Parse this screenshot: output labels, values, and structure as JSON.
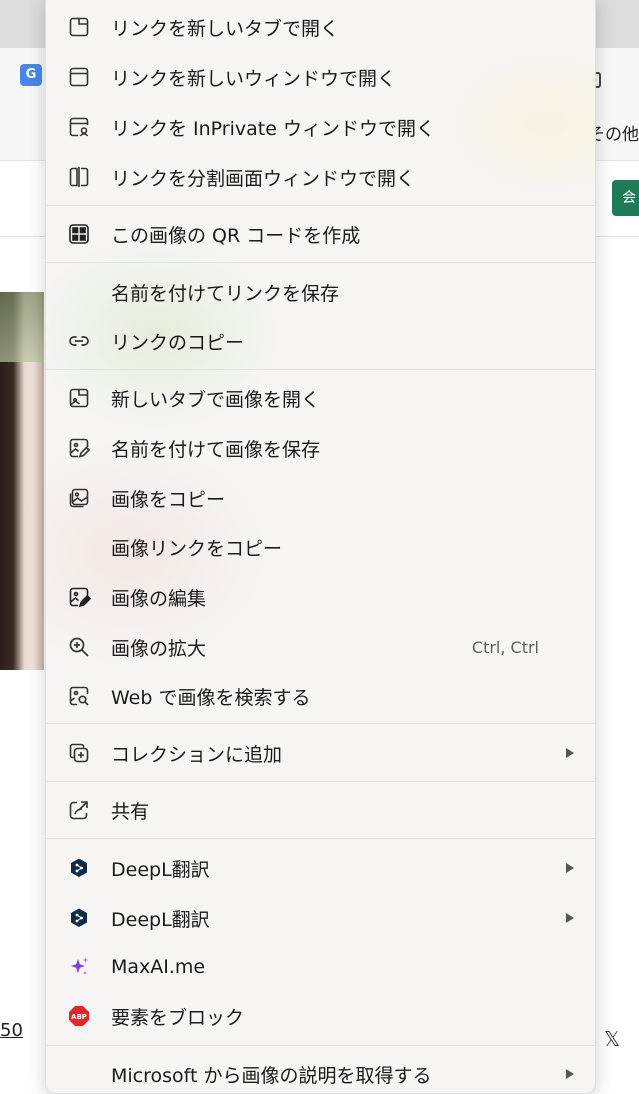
{
  "background": {
    "other_label": "その他",
    "green_button_label": "会",
    "link_fragment": "50",
    "x_logo": "𝕏"
  },
  "menu": {
    "items": [
      {
        "label": "リンクを新しいタブで開く",
        "icon": "new-tab-icon"
      },
      {
        "label": "リンクを新しいウィンドウで開く",
        "icon": "new-window-icon"
      },
      {
        "label": "リンクを InPrivate ウィンドウで開く",
        "icon": "inprivate-window-icon"
      },
      {
        "label": "リンクを分割画面ウィンドウで開く",
        "icon": "split-screen-icon"
      },
      {
        "label": "この画像の QR コードを作成",
        "icon": "qr-code-icon"
      },
      {
        "label": "名前を付けてリンクを保存",
        "icon": ""
      },
      {
        "label": "リンクのコピー",
        "icon": "link-icon"
      },
      {
        "label": "新しいタブで画像を開く",
        "icon": "image-new-tab-icon"
      },
      {
        "label": "名前を付けて画像を保存",
        "icon": "save-image-icon"
      },
      {
        "label": "画像をコピー",
        "icon": "copy-image-icon"
      },
      {
        "label": "画像リンクをコピー",
        "icon": ""
      },
      {
        "label": "画像の編集",
        "icon": "edit-image-icon"
      },
      {
        "label": "画像の拡大",
        "icon": "zoom-in-icon",
        "shortcut": "Ctrl, Ctrl"
      },
      {
        "label": "Web で画像を検索する",
        "icon": "visual-search-icon"
      },
      {
        "label": "コレクションに追加",
        "icon": "collections-add-icon",
        "submenu": true
      },
      {
        "label": "共有",
        "icon": "share-icon"
      },
      {
        "label": "DeepL翻訳",
        "icon": "deepl-icon",
        "submenu": true
      },
      {
        "label": "DeepL翻訳",
        "icon": "deepl-icon",
        "submenu": true
      },
      {
        "label": "MaxAI.me",
        "icon": "maxai-sparkle-icon"
      },
      {
        "label": "要素をブロック",
        "icon": "abp-block-icon"
      },
      {
        "label": "Microsoft から画像の説明を取得する",
        "icon": "",
        "submenu": true
      }
    ],
    "colors": {
      "deepl": "#0f2b46",
      "maxai": "#7b3fe4",
      "abp": "#e0262f"
    }
  }
}
